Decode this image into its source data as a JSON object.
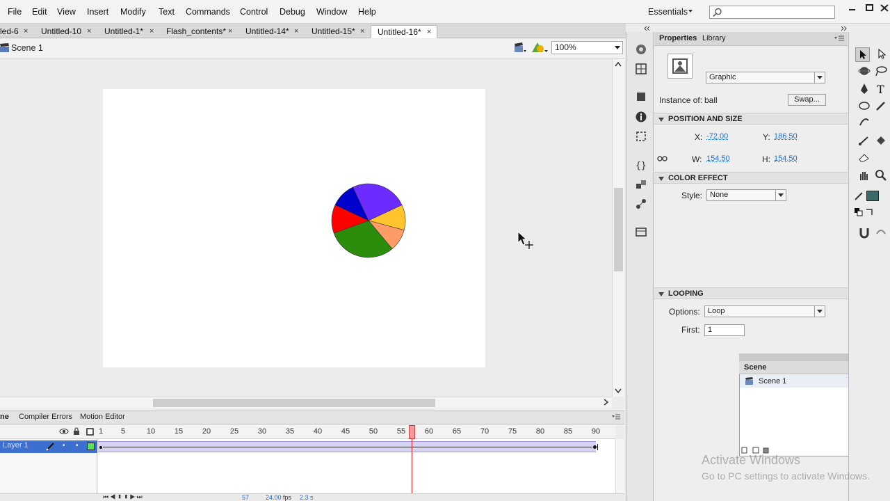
{
  "menubar": {
    "items": [
      "File",
      "Edit",
      "View",
      "Insert",
      "Modify",
      "Text",
      "Commands",
      "Control",
      "Debug",
      "Window",
      "Help"
    ],
    "workspace": "Essentials",
    "search_placeholder": ""
  },
  "tabs": [
    {
      "label": "led-6",
      "active": false
    },
    {
      "label": "Untitled-10",
      "active": false
    },
    {
      "label": "Untitled-1*",
      "active": false
    },
    {
      "label": "Flash_contents*",
      "active": false
    },
    {
      "label": "Untitled-14*",
      "active": false
    },
    {
      "label": "Untitled-15*",
      "active": false
    },
    {
      "label": "Untitled-16*",
      "active": true
    }
  ],
  "tab_close": "×",
  "scene_bar": {
    "scene_label": "Scene 1",
    "zoom": "100%"
  },
  "stage": {
    "pie_colors": [
      "#6c2cff",
      "#ffc42e",
      "#ff9c66",
      "#2c8c0c",
      "#ff0000",
      "#0000cc"
    ]
  },
  "timeline": {
    "tabs": [
      "ne",
      "Compiler Errors",
      "Motion Editor"
    ],
    "frame_numbers": [
      "1",
      "5",
      "10",
      "15",
      "20",
      "25",
      "30",
      "35",
      "40",
      "45",
      "50",
      "55",
      "60",
      "65",
      "70",
      "75",
      "80",
      "85",
      "90"
    ],
    "layer_name": "Layer 1",
    "status": {
      "frame": "57",
      "fps": "24.00",
      "fps_unit": "fps",
      "time": "2.3 s"
    }
  },
  "properties": {
    "tabs": [
      "Properties",
      "Library"
    ],
    "instance_type": "Graphic",
    "instance_of_label": "Instance of:",
    "instance_of_value": "ball",
    "swap_label": "Swap...",
    "position_header": "POSITION AND SIZE",
    "x_label": "X:",
    "x_value": "-72.00",
    "y_label": "Y:",
    "y_value": "186.50",
    "w_label": "W:",
    "w_value": "154.50",
    "h_label": "H:",
    "h_value": "154.50",
    "color_effect_header": "COLOR EFFECT",
    "style_label": "Style:",
    "style_value": "None",
    "looping_header": "LOOPING",
    "options_label": "Options:",
    "options_value": "Loop",
    "first_label": "First:",
    "first_value": "1"
  },
  "scene_panel": {
    "title": "Scene",
    "item": "Scene 1"
  },
  "watermark": {
    "line1": "Activate Windows",
    "line2": "Go to PC settings to activate Windows."
  }
}
